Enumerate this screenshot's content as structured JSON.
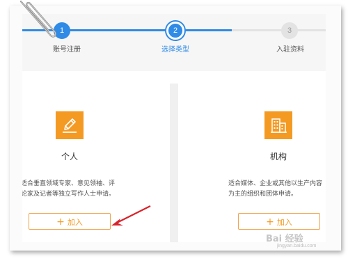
{
  "steps": [
    {
      "number": "1",
      "label": "账号注册",
      "state": "done"
    },
    {
      "number": "2",
      "label": "选择类型",
      "state": "current"
    },
    {
      "number": "3",
      "label": "入驻资料",
      "state": "pending"
    }
  ],
  "cards": {
    "personal": {
      "icon": "pencil-icon",
      "title": "个人",
      "desc_line1": "适合垂直领域专家、意见领袖、评",
      "desc_line2": "论家及记者等独立写作人士申请。",
      "button_plus": "+",
      "button_label": "加入"
    },
    "organization": {
      "icon": "building-icon",
      "title": "机构",
      "desc_line1": "适合媒体、企业或其他以生产内容",
      "desc_line2": "为主的组织和团体申请。",
      "button_plus": "+",
      "button_label": "加入"
    }
  },
  "watermark": {
    "text": "Bai 经验",
    "sub": "jingyan.baidu.com"
  },
  "colors": {
    "accent_blue": "#2f8be6",
    "accent_orange": "#f49a23",
    "annotation_red": "#d9222a"
  }
}
